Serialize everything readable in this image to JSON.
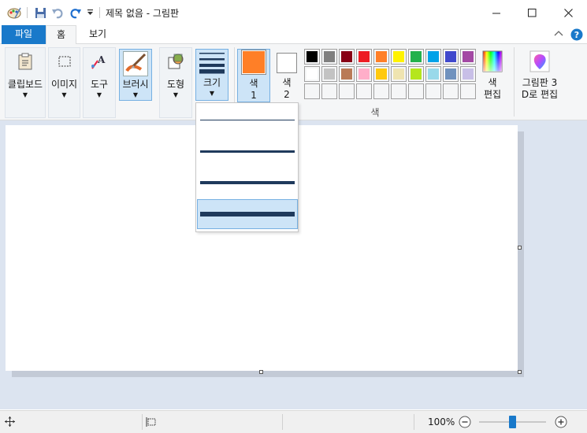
{
  "window": {
    "title": "제목 없음 - 그림판"
  },
  "tabs": [
    {
      "label": "파일"
    },
    {
      "label": "홈"
    },
    {
      "label": "보기"
    }
  ],
  "ribbon": {
    "clipboard": "클립보드",
    "image": "이미지",
    "tools": "도구",
    "brushes": "브러시",
    "shapes": "도형",
    "size": "크기",
    "color1_a": "색",
    "color1_b": "1",
    "color2_a": "색",
    "color2_b": "2",
    "colors_group": "색",
    "edit_colors_a": "색",
    "edit_colors_b": "편집",
    "paint3d_a": "그림판 3",
    "paint3d_b": "D로 편집"
  },
  "colors": {
    "color1": "#ff7f27",
    "color2": "#ffffff",
    "palette_row1": [
      "#000000",
      "#7f7f7f",
      "#880015",
      "#ed1c24",
      "#ff7f27",
      "#fff200",
      "#22b14c",
      "#00a2e8",
      "#3f48cc",
      "#a349a4"
    ],
    "palette_row2": [
      "#ffffff",
      "#c3c3c3",
      "#b97a57",
      "#ffaec9",
      "#ffc90e",
      "#efe4b0",
      "#b5e61d",
      "#99d9ea",
      "#7092be",
      "#c8bfe7"
    ]
  },
  "size_menu": {
    "selected_index": 3
  },
  "status": {
    "zoom": "100%"
  }
}
